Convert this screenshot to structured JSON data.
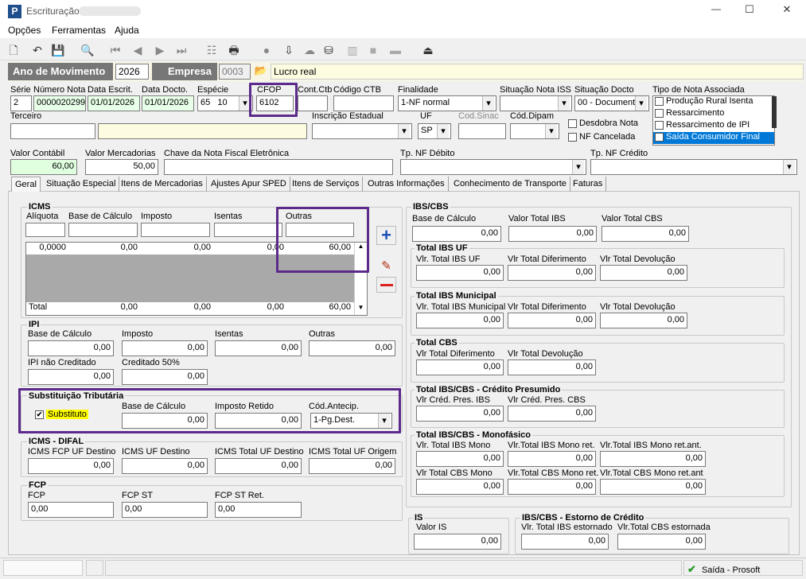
{
  "window": {
    "title": "Escrituração",
    "app_icon": "P",
    "minimize": "—",
    "maximize": "☐",
    "close": "✕"
  },
  "menu": [
    "Opções",
    "Ferramentas",
    "Ajuda"
  ],
  "header": {
    "ano_label": "Ano de Movimento",
    "ano_value": "2026",
    "empresa_label": "Empresa",
    "empresa_value": "0003",
    "regime": "Lucro real"
  },
  "doc": {
    "serie_label": "Série",
    "serie": "2",
    "numero_label": "Número Nota",
    "numero": "0000020299",
    "data_escrit_label": "Data Escrit.",
    "data_escrit": "01/01/2026",
    "data_docto_label": "Data Docto.",
    "data_docto": "01/01/2026",
    "especie_label": "Espécie",
    "especie_code": "65",
    "especie_val": "10",
    "cfop_label": "CFOP",
    "cfop": "6102",
    "cont_ctb_label": "Cont.Ctb",
    "codigo_ctb_label": "Código CTB",
    "finalidade_label": "Finalidade",
    "finalidade": "1-NF normal",
    "situacao_iss_label": "Situação Nota ISS",
    "situacao_docto_label": "Situação Docto",
    "situacao_docto": "00 - Document",
    "tipo_nota_label": "Tipo de Nota Associada",
    "tipo_nota_options": [
      "Produção Rural Isenta",
      "Ressarcimento",
      "Ressarcimento de IPI",
      "Saída Consumidor Final"
    ],
    "terceiro_label": "Terceiro",
    "ie_label": "Inscrição Estadual",
    "uf_label": "UF",
    "uf": "SP",
    "cod_sinac_label": "Cod.Sinac",
    "cod_dipam_label": "Cód.Dipam",
    "desdobra_label": "Desdobra Nota",
    "nf_cancelada_label": "NF Cancelada",
    "valor_contabil_label": "Valor Contábil",
    "valor_contabil": "60,00",
    "valor_merc_label": "Valor Mercadorias",
    "valor_merc": "50,00",
    "chave_label": "Chave da Nota Fiscal Eletrônica",
    "tp_debito_label": "Tp. NF Débito",
    "tp_credito_label": "Tp. NF Crédito"
  },
  "tabs": [
    "Geral",
    "Situação Especial",
    "Itens de Mercadorias",
    "Ajustes Apur SPED",
    "Itens de Serviços",
    "Outras Informações",
    "Conhecimento de Transporte",
    "Faturas"
  ],
  "icms": {
    "title": "ICMS",
    "cols": [
      "Alíquota",
      "Base de Cálculo",
      "Imposto",
      "Isentas",
      "Outras"
    ],
    "row": [
      "0,0000",
      "0,00",
      "0,00",
      "0,00",
      "60,00"
    ],
    "total_label": "Total",
    "total": [
      "0,00",
      "0,00",
      "0,00",
      "60,00"
    ]
  },
  "ipi": {
    "title": "IPI",
    "labels": [
      "Base de Cálculo",
      "Imposto",
      "Isentas",
      "Outras"
    ],
    "values": [
      "0,00",
      "0,00",
      "0,00",
      "0,00"
    ],
    "nao_cred_label": "IPI não Creditado",
    "nao_cred": "0,00",
    "cred50_label": "Creditado 50%",
    "cred50": "0,00"
  },
  "st": {
    "title": "Substituição Tributária",
    "check_label": "Substituto",
    "check": "✔",
    "base_label": "Base de Cálculo",
    "base": "0,00",
    "retido_label": "Imposto Retido",
    "retido": "0,00",
    "antecip_label": "Cód.Antecip.",
    "antecip": "1-Pg.Dest."
  },
  "difal": {
    "title": "ICMS - DIFAL",
    "labels": [
      "ICMS FCP UF Destino",
      "ICMS UF Destino",
      "ICMS Total UF Destino",
      "ICMS Total UF Origem"
    ],
    "values": [
      "0,00",
      "0,00",
      "0,00",
      "0,00"
    ]
  },
  "fcp": {
    "title": "FCP",
    "labels": [
      "FCP",
      "FCP ST",
      "FCP ST Ret."
    ],
    "values": [
      "0,00",
      "0,00",
      "0,00"
    ]
  },
  "ibscbs": {
    "title": "IBS/CBS",
    "labels": [
      "Base de Cálculo",
      "Valor Total IBS",
      "Valor Total CBS"
    ],
    "values": [
      "0,00",
      "0,00",
      "0,00"
    ]
  },
  "ibs_uf": {
    "title": "Total IBS UF",
    "labels": [
      "Vlr. Total IBS UF",
      "Vlr Total Diferimento",
      "Vlr Total Devolução"
    ],
    "values": [
      "0,00",
      "0,00",
      "0,00"
    ]
  },
  "ibs_mun": {
    "title": "Total IBS Municipal",
    "labels": [
      "Vlr. Total IBS Municipal",
      "Vlr Total Diferimento",
      "Vlr Total Devolução"
    ],
    "values": [
      "0,00",
      "0,00",
      "0,00"
    ]
  },
  "cbs": {
    "title": "Total CBS",
    "labels": [
      "Vlr Total Diferimento",
      "Vlr Total Devolução"
    ],
    "values": [
      "0,00",
      "0,00"
    ]
  },
  "cred": {
    "title": "Total IBS/CBS - Crédito Presumido",
    "labels": [
      "Vlr Créd. Pres. IBS",
      "Vlr Créd. Pres. CBS"
    ],
    "values": [
      "0,00",
      "0,00"
    ]
  },
  "mono": {
    "title": "Total IBS/CBS - Monofásico",
    "labels": [
      "Vlr. Total IBS Mono",
      "Vlr.Total IBS Mono ret.",
      "Vlr.Total IBS Mono ret.ant.",
      "Vlr Total CBS Mono",
      "Vlr.Total CBS Mono ret.",
      "Vlr.Total CBS Mono ret.ant"
    ],
    "values": [
      "0,00",
      "0,00",
      "0,00",
      "0,00",
      "0,00",
      "0,00"
    ]
  },
  "is": {
    "title": "IS",
    "label": "Valor IS",
    "value": "0,00"
  },
  "estorno": {
    "title": "IBS/CBS - Estorno de Crédito",
    "labels": [
      "Vlr. Total IBS estornado",
      "Vlr.Total CBS estornada"
    ],
    "values": [
      "0,00",
      "0,00"
    ]
  },
  "status": {
    "text": "Saída - Prosoft"
  }
}
